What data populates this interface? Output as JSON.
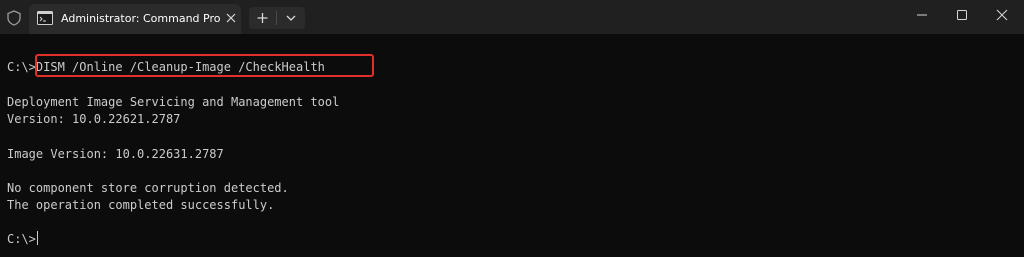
{
  "window": {
    "tab_title": "Administrator: Command Pro",
    "icons": {
      "shield": "shield-icon",
      "tab": "cmd-icon",
      "tab_close": "close-icon",
      "new_tab": "plus-icon",
      "dropdown": "chevron-down-icon",
      "minimize": "minimize-icon",
      "maximize": "maximize-icon",
      "close": "close-icon"
    }
  },
  "terminal": {
    "prompt": "C:\\>",
    "command": "DISM /Online /Cleanup-Image /CheckHealth",
    "output": [
      "Deployment Image Servicing and Management tool",
      "Version: 10.0.22621.2787",
      "Image Version: 10.0.22631.2787",
      "No component store corruption detected.",
      "The operation completed successfully."
    ],
    "final_prompt": "C:\\>"
  },
  "colors": {
    "background": "#0c0c0c",
    "titlebar": "#202020",
    "text": "#cccccc",
    "highlight": "#e0302a"
  }
}
